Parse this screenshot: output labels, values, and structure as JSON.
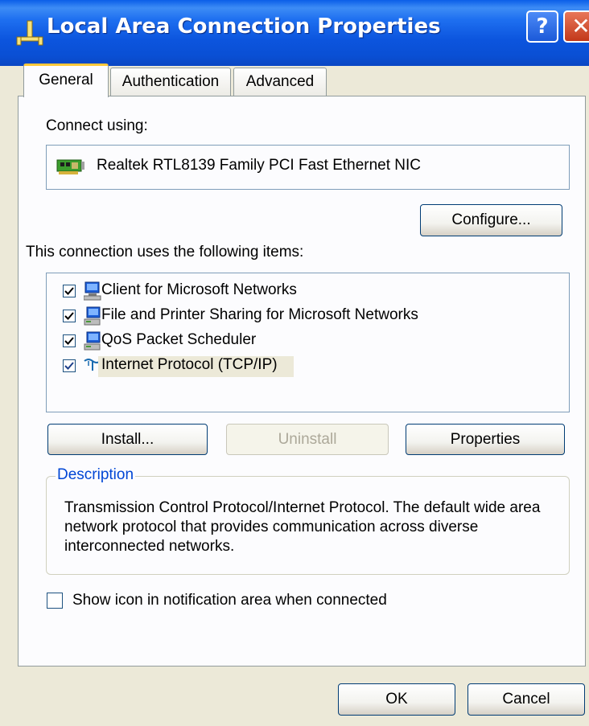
{
  "window": {
    "title": "Local Area Connection Properties",
    "help_label": "?",
    "close_label": "✕"
  },
  "tabs": [
    {
      "label": "General",
      "selected": true
    },
    {
      "label": "Authentication",
      "selected": false
    },
    {
      "label": "Advanced",
      "selected": false
    }
  ],
  "general": {
    "connect_using_label": "Connect using:",
    "adapter_name": "Realtek RTL8139 Family PCI Fast Ethernet NIC",
    "configure_label": "Configure...",
    "items_label": "This connection uses the following items:",
    "items": [
      {
        "label": "Client for Microsoft Networks",
        "checked": true,
        "icon": "network-client-icon"
      },
      {
        "label": "File and Printer Sharing for Microsoft Networks",
        "checked": true,
        "icon": "network-service-icon"
      },
      {
        "label": "QoS Packet Scheduler",
        "checked": true,
        "icon": "network-service-icon"
      },
      {
        "label": "Internet Protocol (TCP/IP)",
        "checked": true,
        "icon": "protocol-icon",
        "selected": true
      }
    ],
    "install_label": "Install...",
    "uninstall_label": "Uninstall",
    "properties_label": "Properties",
    "description_title": "Description",
    "description_text": "Transmission Control Protocol/Internet Protocol. The default wide area network protocol that provides communication across diverse interconnected networks.",
    "show_icon_label": "Show icon in notification area when connected",
    "show_icon_checked": false
  },
  "footer": {
    "ok_label": "OK",
    "cancel_label": "Cancel"
  },
  "colors": {
    "titlebar": "#0a4fd4",
    "dialog_bg": "#ece9d8",
    "tab_highlight": "#ffc83c",
    "group_title": "#0046d5"
  }
}
